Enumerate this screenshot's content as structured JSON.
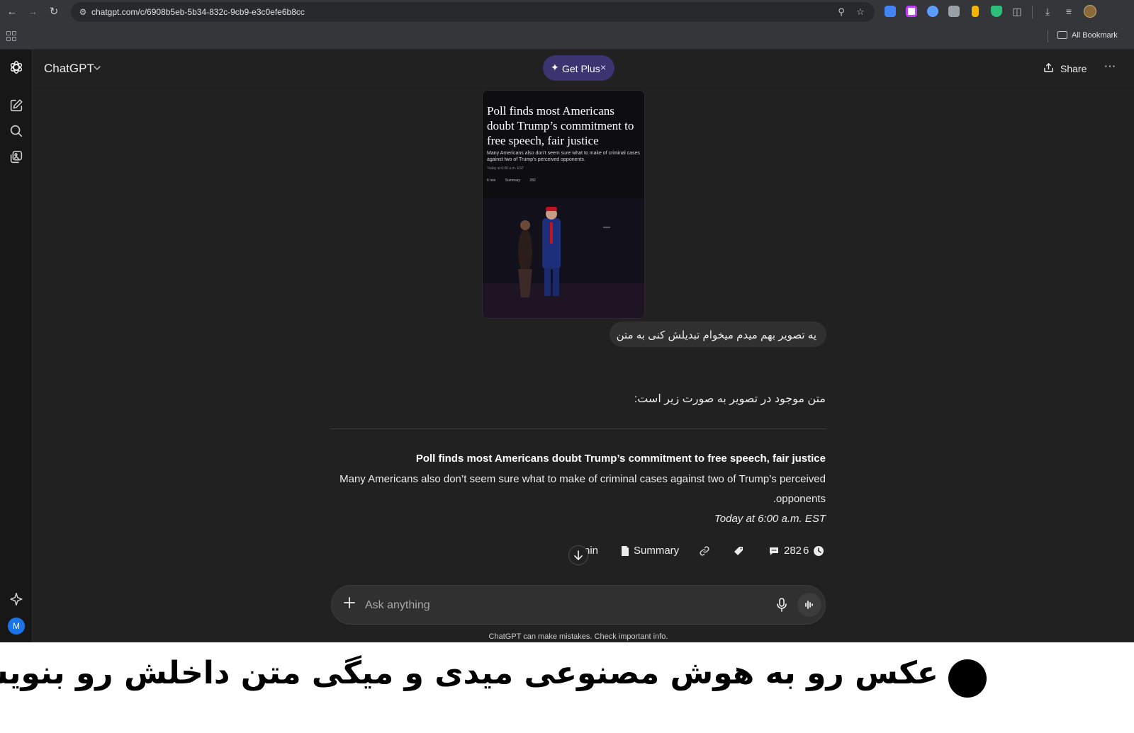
{
  "browser": {
    "url": "chatgpt.com/c/6908b5eb-5b34-832c-9cb9-e3c0efe6b8cc",
    "bookmarks_label": "All Bookmark",
    "extension_colors": [
      "#4285f4",
      "#ffffff",
      "#5b9cff",
      "#9aa0a6",
      "#f4b400",
      "#2bbf7a"
    ]
  },
  "app": {
    "model_name": "ChatGPT",
    "get_plus_label": "Get Plus",
    "get_plus_close": "×",
    "share_label": "Share",
    "avatar_initial": "M",
    "accent_color": "#3a3470"
  },
  "conversation": {
    "user_image": {
      "headline": "Poll finds most Americans doubt Trump’s commitment to free speech, fair justice",
      "subhead": "Many Americans also don’t seem sure what to make of criminal cases against two of Trump’s perceived opponents.",
      "date": "Today at 6:00 a.m. EST",
      "meta": [
        "6 min",
        "Summary",
        "282"
      ]
    },
    "user_message": "یه تصویر بهم میدم میخوام تبدیلش کنی به متن",
    "assistant": {
      "intro": "متن موجود در تصویر به صورت زیر است:",
      "title": "Poll finds most Americans doubt Trump’s commitment to free speech, fair justice",
      "subtitle_line1": "Many Americans also don’t seem sure what to make of criminal cases against two of Trump’s perceived",
      "subtitle_line2": ".opponents",
      "date": "Today at 6:00 a.m. EST",
      "meta": {
        "read_time": "nin",
        "summary": "Summary",
        "comments": "282",
        "clock_value": "6"
      }
    }
  },
  "composer": {
    "placeholder": "Ask anything",
    "disclaimer": "ChatGPT can make mistakes. Check important info."
  },
  "caption": {
    "text": "عکس رو به هوش مصنوعی میدی و میگی متن داخلش رو بنویسه"
  }
}
